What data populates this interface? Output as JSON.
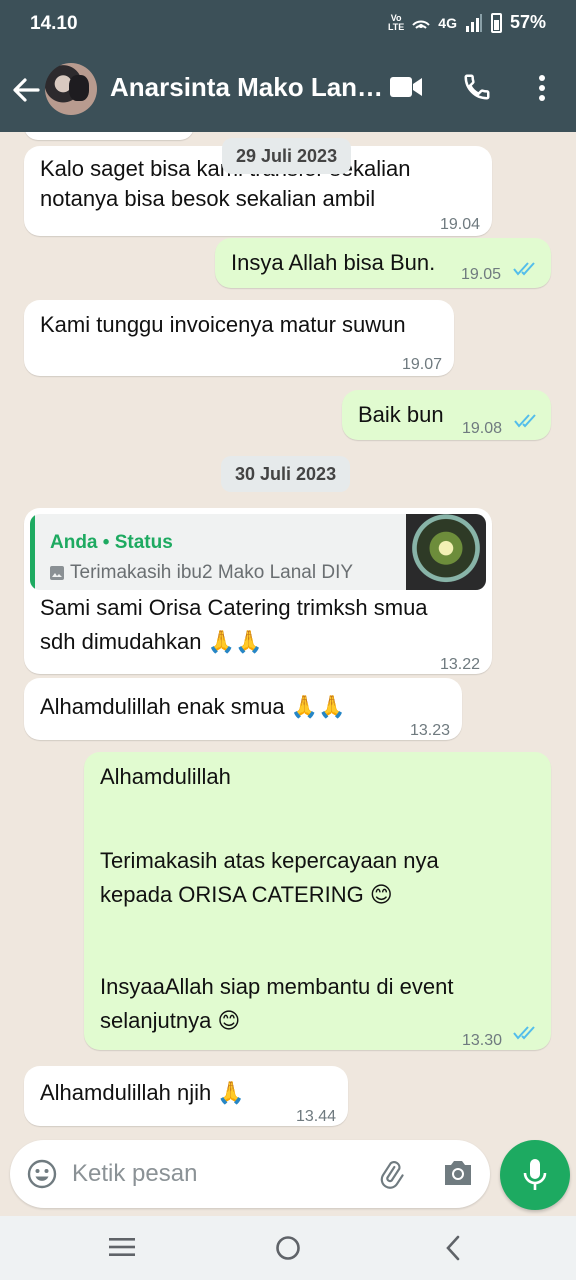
{
  "status_bar": {
    "time": "14.10",
    "network": "4G",
    "volte": "Vo LTE",
    "battery": "57%"
  },
  "header": {
    "contact_name": "Anarsinta Mako Lan…"
  },
  "messages": [
    {
      "direction": "in",
      "text_lines": [
        "Kalo saget bisa kami transfer sekalian",
        "notanya bisa besok sekalian ambil"
      ],
      "time": "19.04"
    },
    {
      "direction": "out",
      "text_lines": [
        "Insya Allah bisa Bun."
      ],
      "time": "19.05",
      "status": "read"
    },
    {
      "direction": "in",
      "text_lines": [
        "Kami tunggu invoicenya matur suwun"
      ],
      "time": "19.07"
    },
    {
      "direction": "out",
      "text_lines": [
        "Baik bun"
      ],
      "time": "19.08",
      "status": "read"
    },
    {
      "direction": "in",
      "reply": {
        "title": "Anda • Status",
        "body": "Terimakasih ibu2 Mako Lanal DIY"
      },
      "text_lines": [
        "Sami sami Orisa Catering  trimksh smua",
        "sdh dimudahkan 🙏🙏"
      ],
      "time": "13.22"
    },
    {
      "direction": "in",
      "text_lines": [
        "Alhamdulillah enak smua 🙏🙏"
      ],
      "time": "13.23"
    },
    {
      "direction": "out",
      "text_lines": [
        "Alhamdulillah",
        "",
        "Terimakasih atas kepercayaan nya",
        "kepada ORISA CATERING 😊",
        "",
        "InsyaaAllah siap membantu di event",
        "selanjutnya 😊"
      ],
      "time": "13.30",
      "status": "read"
    },
    {
      "direction": "in",
      "text_lines": [
        "Alhamdulillah njih 🙏"
      ],
      "time": "13.44"
    }
  ],
  "date_dividers": [
    "29 Juli 2023",
    "30 Juli 2023"
  ],
  "input": {
    "placeholder": "Ketik pesan"
  },
  "colors": {
    "header_bg": "#3c5058",
    "outgoing_bubble": "#e1fbd0",
    "incoming_bubble": "#ffffff",
    "accent_green": "#1daa61",
    "read_ticks": "#53bdeb",
    "chat_bg": "#efe7de"
  },
  "icons": [
    "back-arrow-icon",
    "video-call-icon",
    "phone-icon",
    "more-vert-icon",
    "emoji-icon",
    "attach-icon",
    "camera-icon",
    "mic-icon",
    "image-icon",
    "double-check-icon",
    "folded-hands-emoji",
    "smiling-face-emoji"
  ]
}
